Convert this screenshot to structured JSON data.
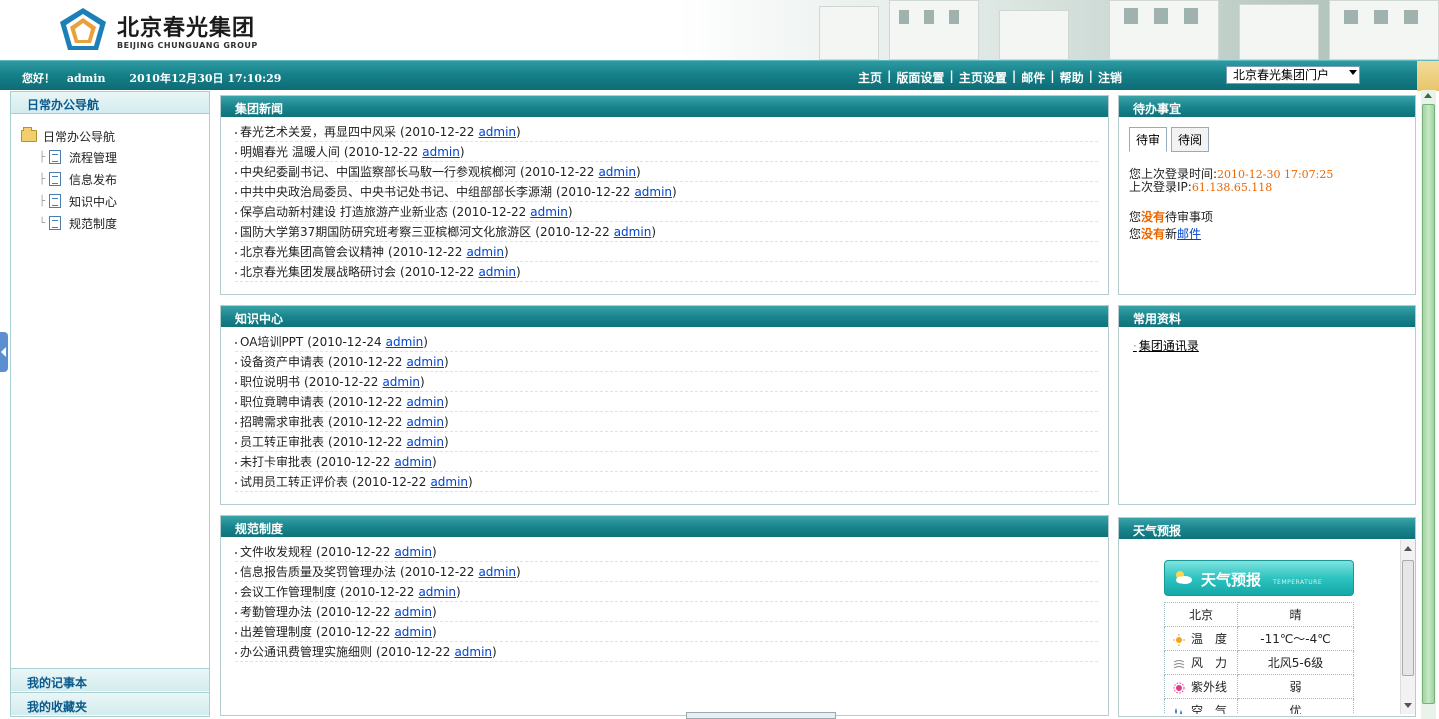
{
  "header": {
    "logo_cn": "北京春光集团",
    "logo_en": "BEIJING CHUNGUANG GROUP"
  },
  "topbar": {
    "greeting": "您好！",
    "username": "admin",
    "datetime": "2010年12月30日  17:10:29",
    "nav": [
      "主页",
      "版面设置",
      "主页设置",
      "邮件",
      "帮助",
      "注销"
    ],
    "portal_selected": "北京春光集团门户"
  },
  "sidebar": {
    "title": "日常办公导航",
    "root": "日常办公导航",
    "items": [
      "流程管理",
      "信息发布",
      "知识中心",
      "规范制度"
    ],
    "bottom": [
      "我的记事本",
      "我的收藏夹"
    ]
  },
  "news": {
    "title": "集团新闻",
    "items": [
      {
        "text": "春光艺术关爱，再显四中风采",
        "date": "(2010-12-22",
        "author": "admin",
        "close": ")"
      },
      {
        "text": "明媚春光  温暖人间",
        "date": "(2010-12-22",
        "author": "admin",
        "close": ")"
      },
      {
        "text": "中央纪委副书记、中国监察部长马駇一行参观槟榔河",
        "date": "(2010-12-22",
        "author": "admin",
        "close": ")"
      },
      {
        "text": "中共中央政治局委员、中央书记处书记、中组部部长李源潮",
        "date": "(2010-12-22",
        "author": "admin",
        "close": ")"
      },
      {
        "text": "保亭启动新村建设  打造旅游产业新业态",
        "date": "(2010-12-22",
        "author": "admin",
        "close": ")"
      },
      {
        "text": "国防大学第37期国防研究班考察三亚槟榔河文化旅游区",
        "date": "(2010-12-22",
        "author": "admin",
        "close": ")"
      },
      {
        "text": "北京春光集团高管会议精神",
        "date": "(2010-12-22",
        "author": "admin",
        "close": ")"
      },
      {
        "text": "北京春光集团发展战略研讨会",
        "date": "(2010-12-22",
        "author": "admin",
        "close": ")"
      }
    ]
  },
  "knowledge": {
    "title": "知识中心",
    "items": [
      {
        "text": "OA培训PPT",
        "date": "(2010-12-24",
        "author": "admin",
        "close": ")"
      },
      {
        "text": "设备资产申请表",
        "date": "(2010-12-22",
        "author": "admin",
        "close": ")"
      },
      {
        "text": "职位说明书",
        "date": "(2010-12-22",
        "author": "admin",
        "close": ")"
      },
      {
        "text": "职位竟聘申请表",
        "date": "(2010-12-22",
        "author": "admin",
        "close": ")"
      },
      {
        "text": "招聘需求审批表",
        "date": "(2010-12-22",
        "author": "admin",
        "close": ")"
      },
      {
        "text": "员工转正审批表",
        "date": "(2010-12-22",
        "author": "admin",
        "close": ")"
      },
      {
        "text": "未打卡审批表",
        "date": "(2010-12-22",
        "author": "admin",
        "close": ")"
      },
      {
        "text": "试用员工转正评价表",
        "date": "(2010-12-22",
        "author": "admin",
        "close": ")"
      }
    ]
  },
  "rules": {
    "title": "规范制度",
    "items": [
      {
        "text": "文件收发规程",
        "date": "(2010-12-22",
        "author": "admin",
        "close": ")"
      },
      {
        "text": "信息报告质量及奖罚管理办法",
        "date": "(2010-12-22",
        "author": "admin",
        "close": ")"
      },
      {
        "text": "会议工作管理制度",
        "date": "(2010-12-22",
        "author": "admin",
        "close": ")"
      },
      {
        "text": "考勤管理办法",
        "date": "(2010-12-22",
        "author": "admin",
        "close": ")"
      },
      {
        "text": "出差管理制度",
        "date": "(2010-12-22",
        "author": "admin",
        "close": ")"
      },
      {
        "text": "办公通讯费管理实施细则",
        "date": "(2010-12-22",
        "author": "admin",
        "close": ")"
      }
    ]
  },
  "todo": {
    "title": "待办事宜",
    "tabs": [
      "待审",
      "待阅"
    ],
    "last_login_label": "您上次登录时间:",
    "last_login_time": "2010-12-30 17:07:25",
    "last_ip_label": "上次登录IP:",
    "last_ip": "61.138.65.118",
    "line1_prefix": "您",
    "line1_mid": "没有",
    "line1_suffix": "待审事项",
    "line2_prefix": "您",
    "line2_mid": "没有",
    "line2_suffix": "新",
    "line2_link": "邮件"
  },
  "resources": {
    "title": "常用资料",
    "link": "集团通讯录"
  },
  "weather": {
    "title": "天气预报",
    "banner_title": "天气预报",
    "banner_sub": "TEMPERATURE",
    "city": "北京",
    "condition": "晴",
    "rows": [
      {
        "label": "温　度",
        "value": "-11℃～-4℃",
        "icon": "sun-icon"
      },
      {
        "label": "风　力",
        "value": "北风5-6级",
        "icon": "wind-icon"
      },
      {
        "label": "紫外线",
        "value": "弱",
        "icon": "uv-icon"
      },
      {
        "label": "空　气",
        "value": "优",
        "icon": "air-icon"
      }
    ]
  },
  "colors": {
    "accent": "#16818a",
    "link": "#0044cc",
    "highlight": "#ee6600"
  }
}
